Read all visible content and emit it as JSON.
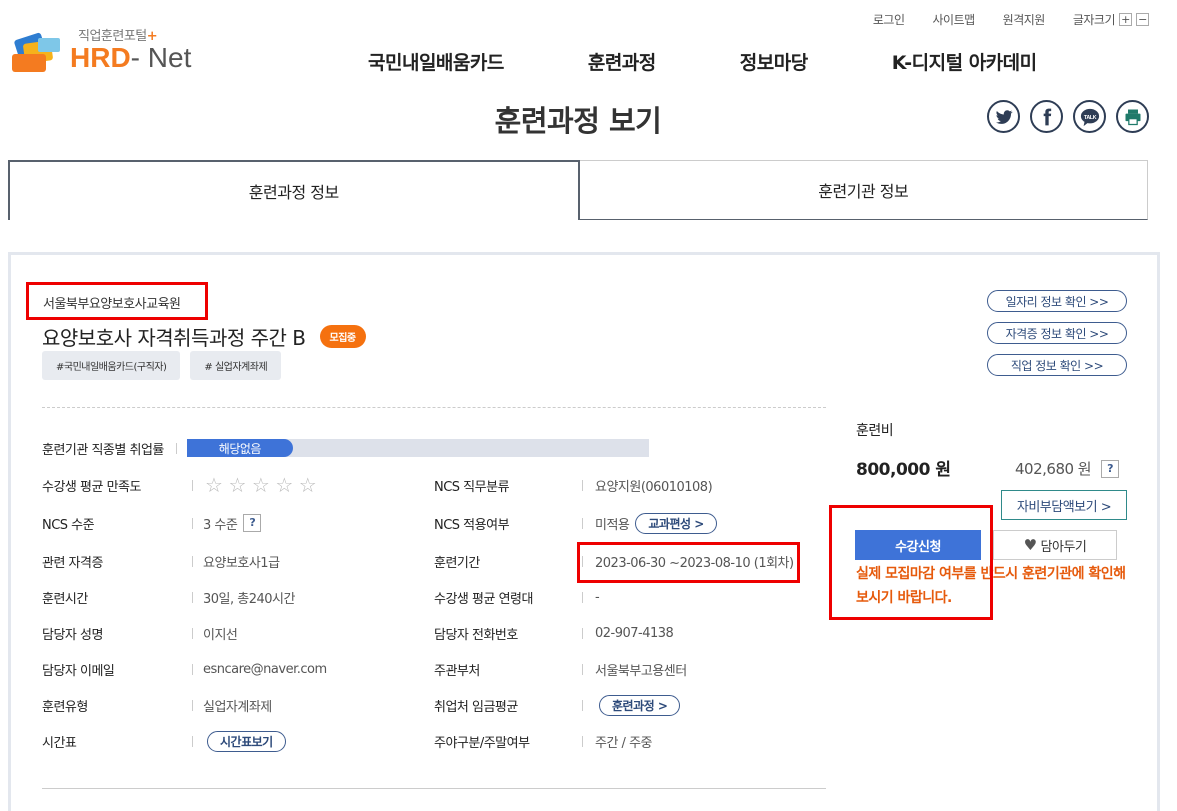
{
  "header": {
    "logo_sub": "직업훈련포털",
    "logo_plus": "+",
    "logo_brand": "HRD",
    "logo_net": "- Net",
    "util_links": [
      "로그인",
      "사이트맵",
      "원격지원"
    ],
    "font_size_label": "글자크기",
    "font_plus": "+",
    "font_minus": "−",
    "nav": [
      "국민내일배움카드",
      "훈련과정",
      "정보마당",
      "K-디지털 아카데미"
    ]
  },
  "page_title": "훈련과정 보기",
  "sns_icons": [
    "twitter-icon",
    "facebook-icon",
    "kakaotalk-icon",
    "print-icon"
  ],
  "sns_talk": "TALK",
  "tabs": [
    "훈련과정 정보",
    "훈련기관 정보"
  ],
  "course": {
    "institution": "서울북부요양보호사교육원",
    "title": "요양보호사 자격취득과정 주간 B",
    "status": "모집중",
    "tags": [
      "#국민내일배움카드(구직자)",
      "# 실업자계좌제"
    ]
  },
  "side_links": [
    "일자리 정보 확인 >>",
    "자격증 정보 확인 >>",
    "직업 정보 확인 >>"
  ],
  "info": {
    "employment_rate_label": "훈련기관 직종별 취업률",
    "employment_rate_value": "해당없음",
    "satisfaction_label": "수강생 평균 만족도",
    "satisfaction_stars": 0,
    "ncs_category_label": "NCS 직무분류",
    "ncs_category_value": "요양지원(06010108)",
    "ncs_level_label": "NCS 수준",
    "ncs_level_value": "3 수준",
    "ncs_apply_label": "NCS 적용여부",
    "ncs_apply_value": "미적용",
    "curriculum_btn": "교과편성 >",
    "cert_label": "관련 자격증",
    "cert_value": "요양보호사1급",
    "period_label": "훈련기간",
    "period_value": "2023-06-30 ~2023-08-10 (1회차)",
    "hours_label": "훈련시간",
    "hours_value": "30일, 총240시간",
    "age_label": "수강생 평균 연령대",
    "age_value": "-",
    "manager_label": "담당자 성명",
    "manager_value": "이지선",
    "phone_label": "담당자 전화번호",
    "phone_value": "02-907-4138",
    "email_label": "담당자 이메일",
    "email_value": "esncare@naver.com",
    "dept_label": "주관부처",
    "dept_value": "서울북부고용센터",
    "type_label": "훈련유형",
    "type_value": "실업자계좌제",
    "wage_label": "취업처 임금평균",
    "wage_btn": "훈련과정 >",
    "timetable_label": "시간표",
    "timetable_btn": "시간표보기",
    "daynight_label": "주야구분/주말여부",
    "daynight_value": "주간 / 주중",
    "help_mark": "?"
  },
  "fee": {
    "label": "훈련비",
    "main": "800,000 원",
    "sub": "402,680 원",
    "self_btn": "자비부담액보기 >",
    "apply_btn": "수강신청",
    "wish_btn": "담아두기",
    "notice": "실제 모집마감 여부를 반드시 훈련기관에 확인해보시기 바랍니다."
  }
}
